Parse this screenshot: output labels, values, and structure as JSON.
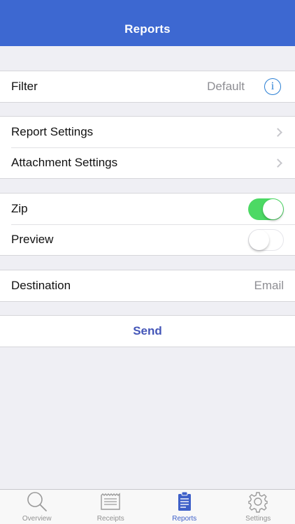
{
  "header": {
    "title": "Reports"
  },
  "filter": {
    "label": "Filter",
    "value": "Default"
  },
  "settings": {
    "report_label": "Report Settings",
    "attachment_label": "Attachment Settings"
  },
  "options": {
    "zip": {
      "label": "Zip",
      "state": "on"
    },
    "preview": {
      "label": "Preview",
      "state": "off"
    }
  },
  "destination": {
    "label": "Destination",
    "value": "Email"
  },
  "send": {
    "label": "Send"
  },
  "tabs": [
    {
      "label": "Overview",
      "icon": "magnifier-icon"
    },
    {
      "label": "Receipts",
      "icon": "receipt-icon"
    },
    {
      "label": "Reports",
      "icon": "clipboard-icon",
      "active": true
    },
    {
      "label": "Settings",
      "icon": "gear-icon"
    }
  ],
  "colors": {
    "accent": "#3d68d1",
    "toggle_on": "#4cd964",
    "info": "#2a7fd4",
    "send": "#4456b8"
  }
}
